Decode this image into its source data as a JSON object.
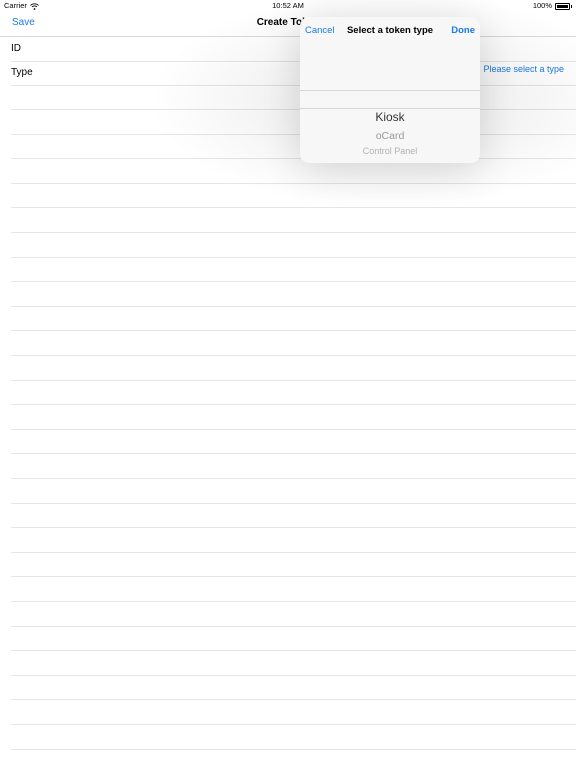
{
  "status_bar": {
    "carrier": "Carrier",
    "time": "10:52 AM",
    "battery": "100%"
  },
  "nav": {
    "save_label": "Save",
    "title": "Create Token"
  },
  "form": {
    "id_label": "ID",
    "type_label": "Type",
    "type_value": "Please select a type"
  },
  "popover": {
    "cancel_label": "Cancel",
    "title": "Select a token type",
    "done_label": "Done",
    "options": [
      "Kiosk",
      "oCard",
      "Control Panel"
    ],
    "selected": "Kiosk"
  },
  "colors": {
    "accent": "#1a7ae6",
    "separator": "#e5e5ea"
  }
}
